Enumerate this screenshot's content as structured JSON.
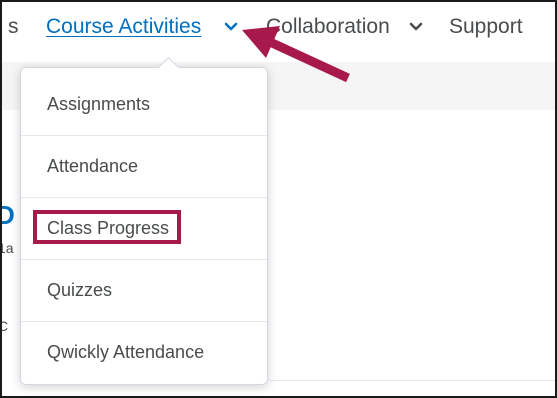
{
  "navbar": {
    "partial_item": "s",
    "course_activities": "Course Activities",
    "collaboration": "Collaboration",
    "support": "Support"
  },
  "page_fragments": {
    "frag_1": "D",
    "frag_2": "1a",
    "frag_3": "C"
  },
  "menu": {
    "items": [
      {
        "label": "Assignments"
      },
      {
        "label": "Attendance"
      },
      {
        "label": "Class Progress",
        "highlighted": true
      },
      {
        "label": "Quizzes"
      },
      {
        "label": "Qwickly Attendance"
      }
    ]
  },
  "colors": {
    "link": "#006fbf",
    "highlight": "#a8194b",
    "arrow": "#a8194b",
    "text": "#494c4e"
  },
  "icons": {
    "course_chevron": "chevron-down-icon",
    "collab_chevron": "chevron-down-icon",
    "annotation": "arrow-pointer-icon"
  }
}
